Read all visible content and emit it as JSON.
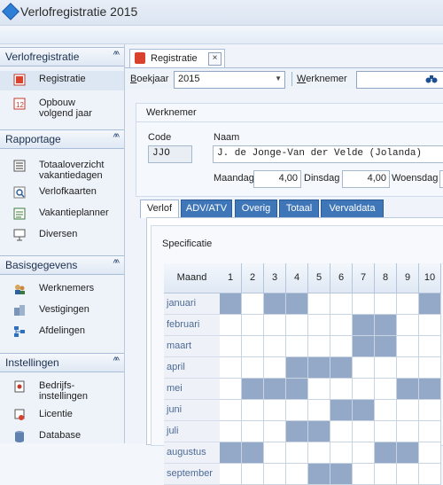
{
  "window": {
    "title": "Verlofregistratie 2015"
  },
  "nav": {
    "groups": [
      {
        "label": "Verlofregistratie",
        "collapse": "^^",
        "items": [
          {
            "label": "Registratie",
            "icon": "registratie-icon"
          },
          {
            "label": "Opbouw volgend jaar",
            "icon": "opbouw-icon"
          }
        ]
      },
      {
        "label": "Rapportage",
        "collapse": "^^",
        "items": [
          {
            "label": "Totaaloverzicht vakantiedagen",
            "icon": "report-icon"
          },
          {
            "label": "Verlofkaarten",
            "icon": "magnifier-icon"
          },
          {
            "label": "Vakantieplanner",
            "icon": "planner-icon"
          },
          {
            "label": "Diversen",
            "icon": "presentation-icon"
          }
        ]
      },
      {
        "label": "Basisgegevens",
        "collapse": "^^",
        "items": [
          {
            "label": "Werknemers",
            "icon": "users-icon"
          },
          {
            "label": "Vestigingen",
            "icon": "buildings-icon"
          },
          {
            "label": "Afdelingen",
            "icon": "hierarchy-icon"
          }
        ]
      },
      {
        "label": "Instellingen",
        "collapse": "^^",
        "items": [
          {
            "label": "Bedrijfs-instellingen",
            "icon": "settings-doc-icon"
          },
          {
            "label": "Licentie",
            "icon": "license-icon"
          },
          {
            "label": "Database",
            "icon": "database-icon"
          }
        ]
      }
    ]
  },
  "tab": {
    "label": "Registratie",
    "close": "×"
  },
  "toolbar": {
    "boekjaar_label_u": "B",
    "boekjaar_label_rest": "oekjaar",
    "boekjaar_value": "2015",
    "werknemer_label_u": "W",
    "werknemer_label_rest": "erknemer",
    "search_value": ""
  },
  "werknemer": {
    "title": "Werknemer",
    "code_label": "Code",
    "naam_label": "Naam",
    "code": "JJO",
    "naam": "J. de Jonge-Van der Velde (Jolanda)",
    "days": [
      {
        "label": "Maandag",
        "value": "4,00"
      },
      {
        "label": "Dinsdag",
        "value": "4,00"
      },
      {
        "label": "Woensdag",
        "value": ""
      }
    ]
  },
  "subtabs": [
    "Verlof",
    "ADV/ATV",
    "Overig",
    "Totaal",
    "Vervaldata"
  ],
  "specificatie": {
    "title": "Specificatie",
    "month_header": "Maand",
    "day_headers": [
      "1",
      "2",
      "3",
      "4",
      "5",
      "6",
      "7",
      "8",
      "9",
      "10"
    ],
    "rows": [
      {
        "month": "januari",
        "cells": [
          1,
          0,
          1,
          1,
          0,
          0,
          0,
          0,
          0,
          1
        ]
      },
      {
        "month": "februari",
        "cells": [
          0,
          0,
          0,
          0,
          0,
          0,
          1,
          1,
          0,
          0
        ]
      },
      {
        "month": "maart",
        "cells": [
          0,
          0,
          0,
          0,
          0,
          0,
          1,
          1,
          0,
          0
        ]
      },
      {
        "month": "april",
        "cells": [
          0,
          0,
          0,
          1,
          1,
          1,
          0,
          0,
          0,
          0
        ]
      },
      {
        "month": "mei",
        "cells": [
          0,
          1,
          1,
          1,
          0,
          0,
          0,
          0,
          1,
          1
        ]
      },
      {
        "month": "juni",
        "cells": [
          0,
          0,
          0,
          0,
          0,
          1,
          1,
          0,
          0,
          0
        ]
      },
      {
        "month": "juli",
        "cells": [
          0,
          0,
          0,
          1,
          1,
          0,
          0,
          0,
          0,
          0
        ]
      },
      {
        "month": "augustus",
        "cells": [
          1,
          1,
          0,
          0,
          0,
          0,
          0,
          1,
          1,
          0
        ]
      },
      {
        "month": "september",
        "cells": [
          0,
          0,
          0,
          0,
          1,
          1,
          0,
          0,
          0,
          0
        ]
      }
    ]
  },
  "colors": {
    "accent": "#3e76b8",
    "marked_cell": "#94a9c8"
  }
}
